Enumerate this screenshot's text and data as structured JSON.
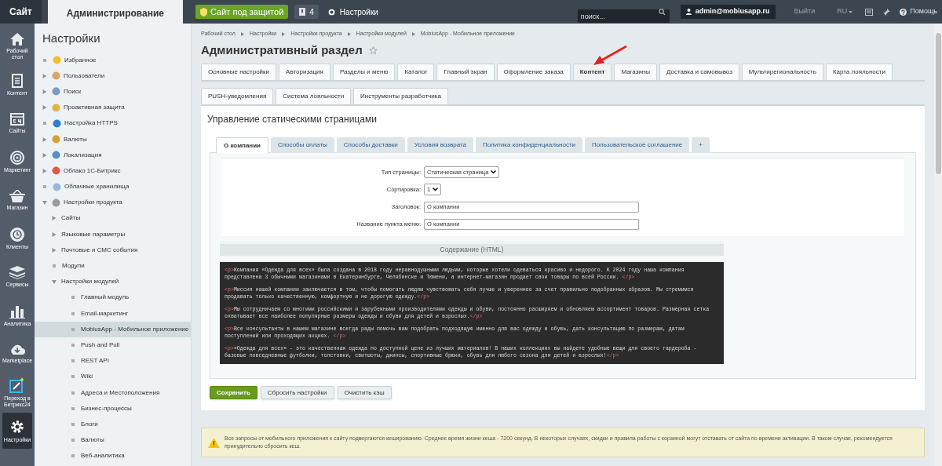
{
  "top_bar": {
    "tabs": [
      {
        "label": "Сайт",
        "selected": false
      },
      {
        "label": "Администрирование",
        "selected": true
      }
    ],
    "protection_button": "Сайт под защитой",
    "notifications_count": "4",
    "settings_link": "Настройки",
    "search": {
      "placeholder": "поиск..."
    },
    "user": "admin@mobiusapp.ru",
    "logout": "Выйти",
    "language": "RU",
    "help": "Помощь"
  },
  "rail": [
    {
      "label": "Рабочий стол",
      "selected": false
    },
    {
      "label": "Контент",
      "selected": false
    },
    {
      "label": "Сайты",
      "selected": false
    },
    {
      "label": "Маркетинг",
      "selected": false
    },
    {
      "label": "Магазин",
      "selected": false
    },
    {
      "label": "Клиенты",
      "selected": false
    },
    {
      "label": "Сервисы",
      "selected": false
    },
    {
      "label": "Аналитика",
      "selected": false
    },
    {
      "label": "Marketplace",
      "selected": false
    },
    {
      "label": "Переход в Битрикс24",
      "selected": false
    },
    {
      "label": "Настройки",
      "selected": true
    }
  ],
  "sidebar": {
    "title": "Настройки",
    "items": [
      {
        "label": "Избранное",
        "expandable": false,
        "expanded": false,
        "selected": false
      },
      {
        "label": "Пользователи",
        "expandable": true,
        "expanded": false,
        "selected": false
      },
      {
        "label": "Поиск",
        "expandable": true,
        "expanded": false,
        "selected": false
      },
      {
        "label": "Проактивная защита",
        "expandable": true,
        "expanded": false,
        "selected": false
      },
      {
        "label": "Настройка HTTPS",
        "expandable": false,
        "expanded": false,
        "selected": false
      },
      {
        "label": "Валюты",
        "expandable": true,
        "expanded": false,
        "selected": false
      },
      {
        "label": "Локализация",
        "expandable": true,
        "expanded": false,
        "selected": false
      },
      {
        "label": "Облако 1С-Битрикс",
        "expandable": true,
        "expanded": false,
        "selected": false
      },
      {
        "label": "Облачные хранилища",
        "expandable": false,
        "expanded": false,
        "selected": false
      },
      {
        "label": "Настройки продукта",
        "expandable": true,
        "expanded": true,
        "selected": false,
        "children": [
          {
            "label": "Сайты",
            "expandable": true,
            "expanded": false,
            "selected": false
          },
          {
            "label": "Языковые параметры",
            "expandable": true,
            "expanded": false,
            "selected": false
          },
          {
            "label": "Почтовые и СМС события",
            "expandable": true,
            "expanded": false,
            "selected": false
          },
          {
            "label": "Модули",
            "expandable": false,
            "expanded": false,
            "selected": false
          },
          {
            "label": "Настройки модулей",
            "expandable": true,
            "expanded": true,
            "selected": false,
            "children": [
              {
                "label": "Главный модуль",
                "expandable": false,
                "expanded": false,
                "selected": false
              },
              {
                "label": "Email-маркетинг",
                "expandable": false,
                "expanded": false,
                "selected": false
              },
              {
                "label": "MobiusApp - Мобильное приложение",
                "expandable": false,
                "expanded": false,
                "selected": true
              },
              {
                "label": "Push and Pull",
                "expandable": false,
                "expanded": false,
                "selected": false
              },
              {
                "label": "REST API",
                "expandable": false,
                "expanded": false,
                "selected": false
              },
              {
                "label": "Wiki",
                "expandable": false,
                "expanded": false,
                "selected": false
              },
              {
                "label": "Адреса и Местоположения",
                "expandable": false,
                "expanded": false,
                "selected": false
              },
              {
                "label": "Бизнес-процессы",
                "expandable": false,
                "expanded": false,
                "selected": false
              },
              {
                "label": "Блоги",
                "expandable": false,
                "expanded": false,
                "selected": false
              },
              {
                "label": "Валюты",
                "expandable": false,
                "expanded": false,
                "selected": false
              },
              {
                "label": "Веб-аналитика",
                "expandable": false,
                "expanded": false,
                "selected": false
              }
            ]
          }
        ]
      }
    ]
  },
  "breadcrumbs": [
    "Рабочий стол",
    "Настройки",
    "Настройки продукта",
    "Настройки модулей",
    "MobiusApp - Мобильное приложение"
  ],
  "page_title": "Административный раздел",
  "tab_rows": [
    [
      {
        "label": "Основные настройки",
        "selected": false
      },
      {
        "label": "Авторизация",
        "selected": false
      },
      {
        "label": "Разделы и меню",
        "selected": false
      },
      {
        "label": "Каталог",
        "selected": false
      },
      {
        "label": "Главный экран",
        "selected": false
      },
      {
        "label": "Оформление заказа",
        "selected": false
      },
      {
        "label": "Контент",
        "selected": true
      },
      {
        "label": "Магазины",
        "selected": false
      },
      {
        "label": "Доставка и самовывоз",
        "selected": false
      },
      {
        "label": "Мультирегиональность",
        "selected": false
      },
      {
        "label": "Карта лояльности",
        "selected": false
      }
    ],
    [
      {
        "label": "PUSH-уведомления",
        "selected": false
      },
      {
        "label": "Система лояльности",
        "selected": false
      },
      {
        "label": "Инструменты разработчика",
        "selected": false
      }
    ]
  ],
  "section_title": "Управление статическими страницами",
  "page_tabs": [
    {
      "label": "О компании",
      "selected": true
    },
    {
      "label": "Способы оплаты",
      "selected": false
    },
    {
      "label": "Способы доставки",
      "selected": false
    },
    {
      "label": "Условия возврата",
      "selected": false
    },
    {
      "label": "Политика конфиденциальности",
      "selected": false
    },
    {
      "label": "Пользовательское соглашение",
      "selected": false
    },
    {
      "label": "+",
      "selected": false
    }
  ],
  "form": [
    {
      "kind": "select",
      "label": "Тип страницы:",
      "value": "Статическая страница"
    },
    {
      "kind": "select",
      "label": "Сортировка:",
      "value": "1"
    },
    {
      "kind": "text",
      "label": "Заголовок:",
      "value": "О компании"
    },
    {
      "kind": "text",
      "label": "Название пункта меню:",
      "value": "О компании"
    }
  ],
  "content_heading": "Содержание (HTML)",
  "code": [
    {
      "open_tag": "<p>",
      "text": "Компания «Одежда для всех» была создана в 2018 году неравнодушными людьми, которые хотели одеваться красиво и недорого. К 2024 году наша компания представлена 3 обычными магазинами в Екатеринбурге, Челябинске и Тюмени, а интернет-магазин продает свои товары по всей России. ",
      "close_tag": "</p>"
    },
    {
      "open_tag": "<p>",
      "text": "Миссия нашей компании заключается в том, чтобы помогать людям чувствовать себя лучше и увереннее за счет правильно подобранных образов. Мы стремимся продавать только качественную, комфортную и не дорогую одежду.",
      "close_tag": "</p>"
    },
    {
      "open_tag": "<p>",
      "text": "Мы сотрудничаем со многими российскими и зарубежными производителями одежды и обуви, постоянно расширяем и обновляем ассортимент товаров. Размерная сетка охватывает все наиболее популярные размеры одежды и обуви для детей и взрослых.",
      "close_tag": "</p>"
    },
    {
      "open_tag": "<p>",
      "text": "Все консультанты в нашем магазине всегда рады помочь вам подобрать подходящую именно для вас одежду и обувь, дать консультацию по размерам, датам поступлений или проходящих акциях. ",
      "close_tag": "</p>"
    },
    {
      "open_tag": "<p>",
      "text": "«Одежда для всех» - это качественная одежда по доступной цене из лучших материалов! В наших коллекциях вы найдете удобные вещи для своего гардероба - базовые повседневные футболки, толстовки, свитшоты, джинсы, спортивные брюки, обувь для любого сезона для детей и взрослых!",
      "close_tag": "</p>"
    }
  ],
  "buttons": [
    {
      "label": "Сохранить",
      "kind": "primary"
    },
    {
      "label": "Сбросить настройки",
      "kind": "default"
    },
    {
      "label": "Очистить кэш",
      "kind": "default"
    }
  ],
  "notice": "Все запросы от мобильного приложения к сайту подвергаются кешированию. Среднее время жизни кеша - 7200 секунд. В некоторых случаях, скидки и правила работы с корзиной могут отставать от сайта по времени активации. В таком случае, рекомендуется принудительно сбросить кеш."
}
